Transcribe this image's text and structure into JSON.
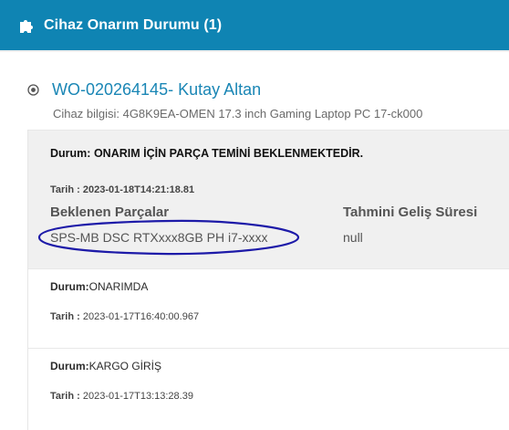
{
  "header": {
    "title": "Cihaz Onarım Durumu (1)",
    "icon": "puzzle-icon",
    "bg_color": "#0f84b3"
  },
  "work_order": {
    "title": "WO-020264145- Kutay Altan",
    "device_info": "Cihaz bilgisi: 4G8K9EA-OMEN 17.3 inch Gaming Laptop PC 17-ck000",
    "icon": "radio-dot-icon"
  },
  "statuses": [
    {
      "label": "Durum:",
      "value": "ONARIM İÇİN PARÇA TEMİNİ BEKLENMEKTEDİR.",
      "date_label": "Tarih :",
      "date": "2023-01-18T14:21:18.81",
      "parts_header": "Beklenen Parçalar",
      "eta_header": "Tahmini Geliş Süresi",
      "parts": [
        {
          "name": "SPS-MB DSC RTXxxx8GB PH i7-xxxx",
          "eta": "null"
        }
      ]
    },
    {
      "label": "Durum:",
      "value": "ONARIMDA",
      "date_label": "Tarih :",
      "date": "2023-01-17T16:40:00.967"
    },
    {
      "label": "Durum:",
      "value": "KARGO GİRİŞ",
      "date_label": "Tarih :",
      "date": "2023-01-17T13:13:28.39"
    }
  ],
  "annotation_color": "#1d1aa8"
}
